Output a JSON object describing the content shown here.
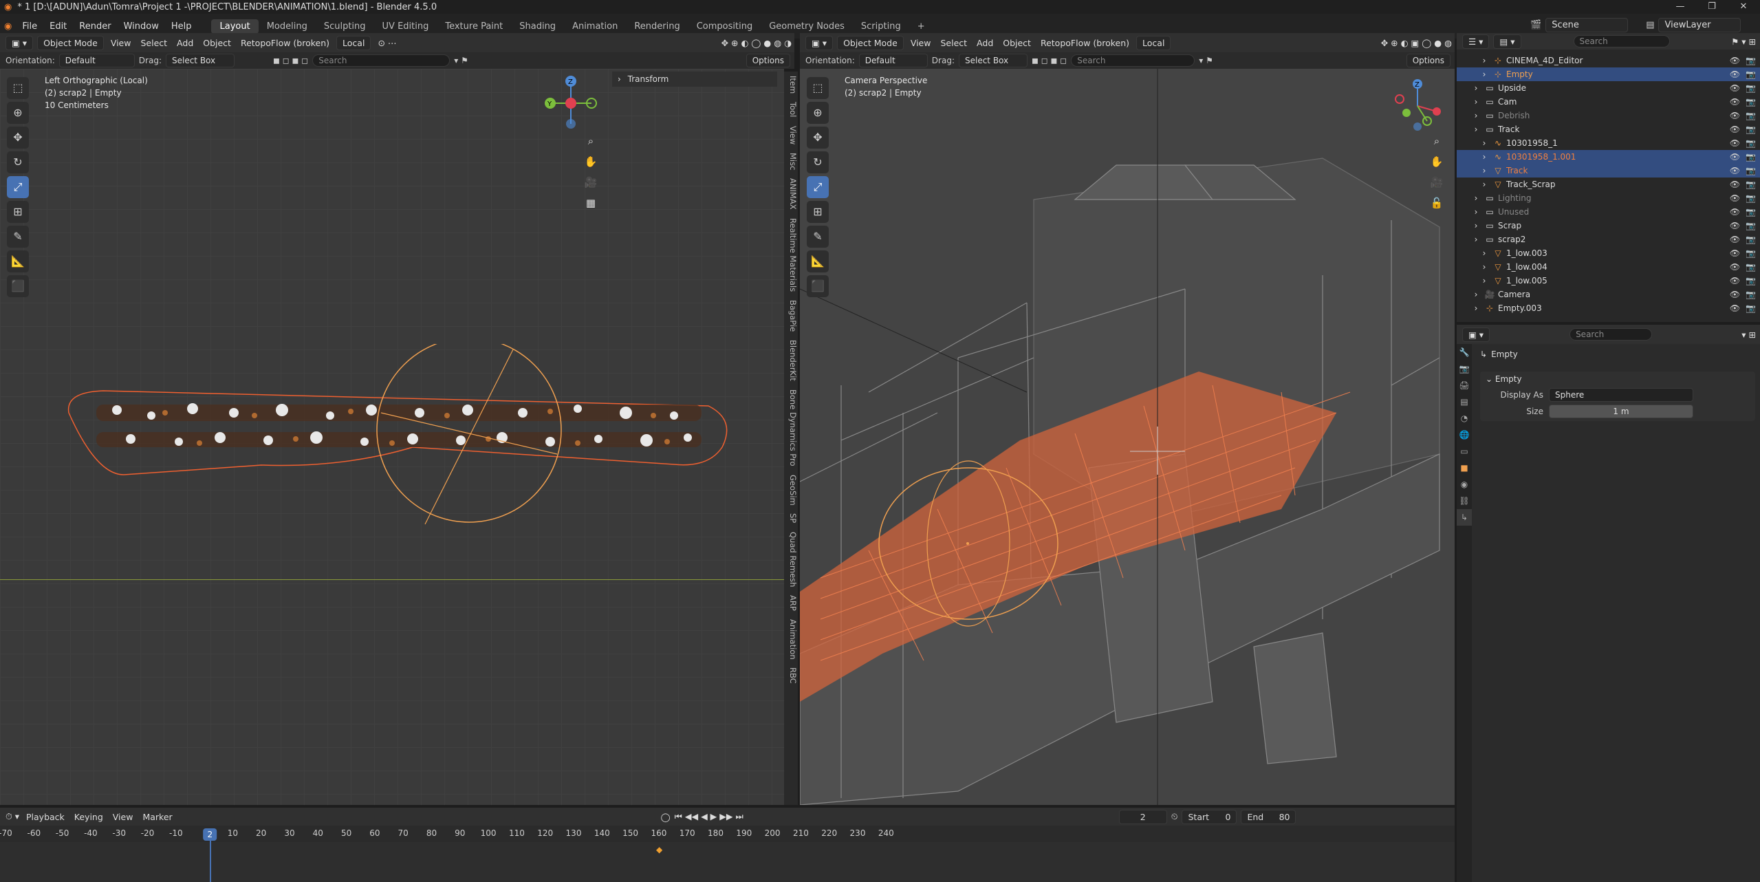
{
  "window": {
    "title": "* 1 [D:\\[ADUN]\\Adun\\Tomra\\Project 1 -\\PROJECT\\BLENDER\\ANIMATION\\1.blend] - Blender 4.5.0"
  },
  "menu": {
    "items": [
      "File",
      "Edit",
      "Render",
      "Window",
      "Help"
    ],
    "workspaces": [
      "Layout",
      "Modeling",
      "Sculpting",
      "UV Editing",
      "Texture Paint",
      "Shading",
      "Animation",
      "Rendering",
      "Compositing",
      "Geometry Nodes",
      "Scripting"
    ],
    "active_workspace": "Layout",
    "add_tab": "+",
    "scene_label": "Scene",
    "viewlayer_label": "ViewLayer"
  },
  "left_viewport": {
    "mode": "Object Mode",
    "menus": [
      "View",
      "Select",
      "Add",
      "Object"
    ],
    "addon": "RetopoFlow (broken)",
    "transform_space": "Local",
    "orientation_label": "Orientation:",
    "orientation_value": "Default",
    "drag_label": "Drag:",
    "drag_value": "Select Box",
    "search_placeholder": "Search",
    "options_label": "Options",
    "overlay_line1": "Left Orthographic (Local)",
    "overlay_line2": "(2) scrap2 | Empty",
    "overlay_line3": "10 Centimeters",
    "panel_title": "Transform",
    "side_tabs": [
      "Item",
      "Tool",
      "View",
      "Misc",
      "ANIMAX",
      "Realtime Materials",
      "BagaPie",
      "BlenderKit",
      "Bone Dynamics Pro",
      "GeoSim",
      "SP",
      "Quad Remesh",
      "ARP",
      "Animation",
      "RBC"
    ],
    "axis_z": "Z",
    "axis_y": "Y"
  },
  "right_viewport": {
    "mode": "Object Mode",
    "menus": [
      "View",
      "Select",
      "Add",
      "Object"
    ],
    "addon": "RetopoFlow (broken)",
    "transform_space": "Local",
    "orientation_label": "Orientation:",
    "orientation_value": "Default",
    "drag_label": "Drag:",
    "drag_value": "Select Box",
    "search_placeholder": "Search",
    "options_label": "Options",
    "overlay_line1": "Camera Perspective",
    "overlay_line2": "(2) scrap2 | Empty",
    "axis_z": "Z"
  },
  "outliner": {
    "search_placeholder": "Search",
    "rows": [
      {
        "label": "CINEMA_4D_Editor",
        "indent": 2,
        "icon": "empty-icon",
        "selected": false,
        "dim": false,
        "color": "#dddddd"
      },
      {
        "label": "Empty",
        "indent": 2,
        "icon": "empty-icon",
        "selected": true,
        "dim": false,
        "color": "#f0a050"
      },
      {
        "label": "Upside",
        "indent": 1,
        "icon": "collection-icon",
        "selected": false,
        "dim": false,
        "color": "#dddddd"
      },
      {
        "label": "Cam",
        "indent": 1,
        "icon": "collection-icon",
        "selected": false,
        "dim": false,
        "color": "#dddddd"
      },
      {
        "label": "Debrish",
        "indent": 1,
        "icon": "collection-icon",
        "selected": false,
        "dim": true,
        "color": "#888888"
      },
      {
        "label": "Track",
        "indent": 1,
        "icon": "collection-icon",
        "selected": false,
        "dim": false,
        "color": "#dddddd"
      },
      {
        "label": "10301958_1",
        "indent": 2,
        "icon": "curve-icon",
        "selected": false,
        "dim": false,
        "color": "#dddddd"
      },
      {
        "label": "10301958_1.001",
        "indent": 2,
        "icon": "curve-icon",
        "selected": true,
        "dim": false,
        "color": "#f08040"
      },
      {
        "label": "Track",
        "indent": 2,
        "icon": "mesh-icon",
        "selected": true,
        "dim": false,
        "color": "#f08040"
      },
      {
        "label": "Track_Scrap",
        "indent": 2,
        "icon": "mesh-icon",
        "selected": false,
        "dim": false,
        "color": "#dddddd"
      },
      {
        "label": "Lighting",
        "indent": 1,
        "icon": "collection-icon",
        "selected": false,
        "dim": true,
        "color": "#888888"
      },
      {
        "label": "Unused",
        "indent": 1,
        "icon": "collection-icon",
        "selected": false,
        "dim": true,
        "color": "#888888"
      },
      {
        "label": "Scrap",
        "indent": 1,
        "icon": "collection-icon",
        "selected": false,
        "dim": false,
        "color": "#dddddd"
      },
      {
        "label": "scrap2",
        "indent": 1,
        "icon": "collection-icon",
        "selected": false,
        "dim": false,
        "color": "#dddddd"
      },
      {
        "label": "1_low.003",
        "indent": 2,
        "icon": "mesh-icon",
        "selected": false,
        "dim": false,
        "color": "#dddddd"
      },
      {
        "label": "1_low.004",
        "indent": 2,
        "icon": "mesh-icon",
        "selected": false,
        "dim": false,
        "color": "#dddddd"
      },
      {
        "label": "1_low.005",
        "indent": 2,
        "icon": "mesh-icon",
        "selected": false,
        "dim": false,
        "color": "#dddddd"
      },
      {
        "label": "Camera",
        "indent": 1,
        "icon": "camera-icon",
        "selected": false,
        "dim": false,
        "color": "#dddddd"
      },
      {
        "label": "Empty.003",
        "indent": 1,
        "icon": "empty-icon",
        "selected": false,
        "dim": false,
        "color": "#dddddd"
      }
    ]
  },
  "properties": {
    "search_placeholder": "Search",
    "object_name": "Empty",
    "panel_title": "Empty",
    "display_as_label": "Display As",
    "display_as_value": "Sphere",
    "size_label": "Size",
    "size_value": "1 m"
  },
  "timeline": {
    "menus": [
      "Playback",
      "Keying",
      "View",
      "Marker"
    ],
    "current_frame": "2",
    "start_label": "Start",
    "start_value": "0",
    "end_label": "End",
    "end_value": "80",
    "ticks": [
      "-70",
      "-60",
      "-50",
      "-40",
      "-30",
      "-20",
      "-10",
      "10",
      "20",
      "30",
      "40",
      "50",
      "60",
      "70",
      "80",
      "90",
      "100",
      "110",
      "120",
      "130",
      "140",
      "150",
      "160",
      "170",
      "180",
      "190",
      "200",
      "210",
      "220",
      "230",
      "240"
    ],
    "playhead": "2"
  },
  "colors": {
    "accent": "#4772b3",
    "selection_orange": "#f08040",
    "active_orange": "#f0a050",
    "playhead_blue": "#4772b3"
  }
}
